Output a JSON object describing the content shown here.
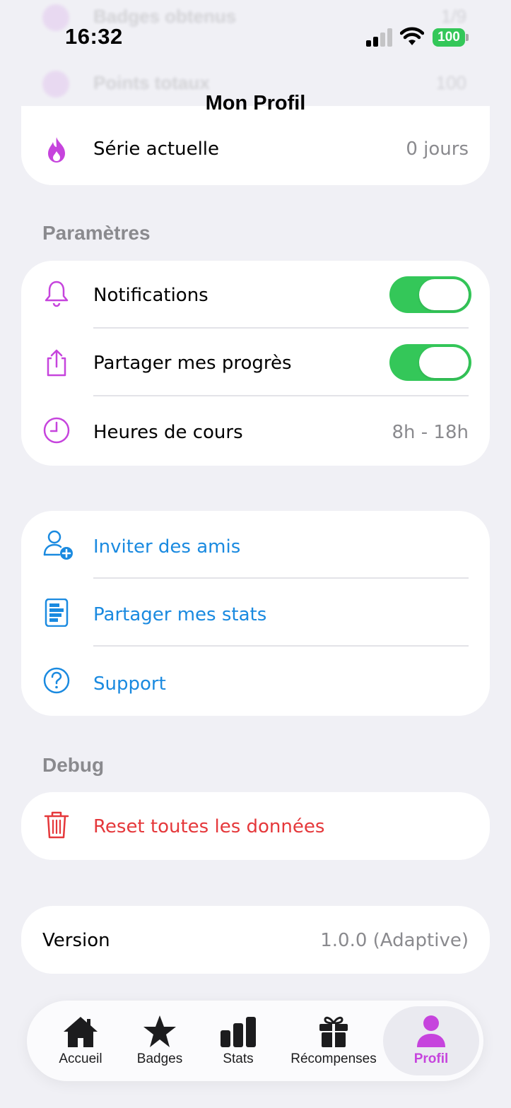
{
  "status": {
    "time": "16:32",
    "battery": "100"
  },
  "header": {
    "title": "Mon Profil",
    "ghost_rows": [
      {
        "label": "Badges obtenus",
        "value": "1/9"
      },
      {
        "label": "Points totaux",
        "value": "100"
      }
    ],
    "streak": {
      "label": "Série actuelle",
      "value": "0 jours"
    }
  },
  "settings": {
    "section_title": "Paramètres",
    "notifications": {
      "label": "Notifications",
      "enabled": true
    },
    "share_progress": {
      "label": "Partager mes progrès",
      "enabled": true
    },
    "class_hours": {
      "label": "Heures de cours",
      "value": "8h - 18h"
    }
  },
  "actions": {
    "invite": "Inviter des amis",
    "share_stats": "Partager mes stats",
    "support": "Support"
  },
  "debug": {
    "section_title": "Debug",
    "reset": "Reset toutes les données"
  },
  "version": {
    "label": "Version",
    "value": "1.0.0 (Adaptive)"
  },
  "tabbar": {
    "tabs": [
      {
        "label": "Accueil",
        "icon": "house-icon"
      },
      {
        "label": "Badges",
        "icon": "star-icon"
      },
      {
        "label": "Stats",
        "icon": "bar-chart-icon"
      },
      {
        "label": "Récompenses",
        "icon": "gift-icon"
      },
      {
        "label": "Profil",
        "icon": "person-icon",
        "active": true
      }
    ]
  },
  "colors": {
    "accent": "#c644dd",
    "link": "#1a8ae0",
    "destructive": "#e5383b",
    "toggle_on": "#34c759"
  }
}
